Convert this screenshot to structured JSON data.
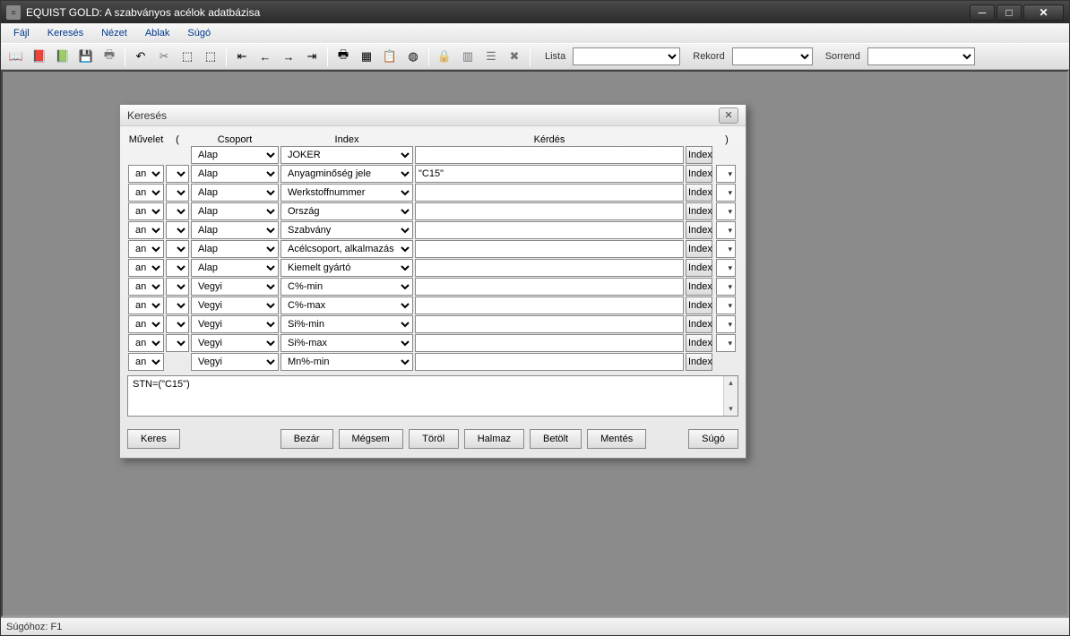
{
  "window": {
    "title": "EQUIST GOLD: A szabványos acélok adatbázisa"
  },
  "menu": {
    "file": "Fájl",
    "search": "Keresés",
    "view": "Nézet",
    "window": "Ablak",
    "help": "Súgó"
  },
  "toolbar": {
    "lista": "Lista",
    "rekord": "Rekord",
    "sorrend": "Sorrend"
  },
  "dialog": {
    "title": "Keresés",
    "headers": {
      "muvelet": "Művelet",
      "lparen": "(",
      "csoport": "Csoport",
      "index": "Index",
      "kerdes": "Kérdés",
      "rparen": ")"
    },
    "rows": [
      {
        "op": "",
        "paren": "",
        "group": "Alap",
        "index": "JOKER",
        "query": "",
        "close": ""
      },
      {
        "op": "and",
        "paren": "",
        "group": "Alap",
        "index": "Anyagminőség jele",
        "query": "\"C15\"",
        "close": ""
      },
      {
        "op": "and",
        "paren": "",
        "group": "Alap",
        "index": "Werkstoffnummer",
        "query": "",
        "close": ""
      },
      {
        "op": "and",
        "paren": "",
        "group": "Alap",
        "index": "Ország",
        "query": "",
        "close": ""
      },
      {
        "op": "and",
        "paren": "",
        "group": "Alap",
        "index": "Szabvány",
        "query": "",
        "close": ""
      },
      {
        "op": "and",
        "paren": "",
        "group": "Alap",
        "index": "Acélcsoport, alkalmazás",
        "query": "",
        "close": ""
      },
      {
        "op": "and",
        "paren": "",
        "group": "Alap",
        "index": "Kiemelt gyártó",
        "query": "",
        "close": ""
      },
      {
        "op": "and",
        "paren": "",
        "group": "Vegyi",
        "index": "C%-min",
        "query": "",
        "close": ""
      },
      {
        "op": "and",
        "paren": "",
        "group": "Vegyi",
        "index": "C%-max",
        "query": "",
        "close": ""
      },
      {
        "op": "and",
        "paren": "",
        "group": "Vegyi",
        "index": "Si%-min",
        "query": "",
        "close": ""
      },
      {
        "op": "and",
        "paren": "",
        "group": "Vegyi",
        "index": "Si%-max",
        "query": "",
        "close": ""
      },
      {
        "op": "and",
        "paren": "",
        "group": "Vegyi",
        "index": "Mn%-min",
        "query": "",
        "close": ""
      }
    ],
    "index_btn": "Index",
    "expression": "STN=(\"C15\")",
    "buttons": {
      "keres": "Keres",
      "bezar": "Bezár",
      "megsem": "Mégsem",
      "torol": "Töröl",
      "halmaz": "Halmaz",
      "betolt": "Betölt",
      "mentes": "Mentés",
      "sugo": "Súgó"
    }
  },
  "statusbar": {
    "text": "Súgóhoz: F1"
  }
}
